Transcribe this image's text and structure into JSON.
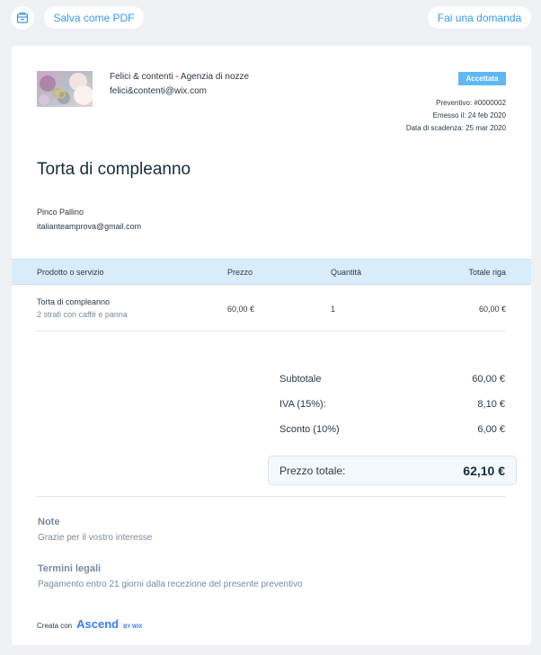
{
  "toolbar": {
    "icon": "archive-icon",
    "save_pdf_label": "Salva come PDF",
    "ask_label": "Fai una domanda"
  },
  "business": {
    "name": "Felici & contenti - Agenzia di nozze",
    "email": "felici&contenti@wix.com"
  },
  "status": {
    "label": "Accettata",
    "color": "#5eb8f5"
  },
  "meta": {
    "number": "Preventivo: #0000002",
    "issued": "Emesso il: 24 feb 2020",
    "due": "Data di scadenza: 25 mar 2020"
  },
  "title": "Torta di compleanno",
  "client": {
    "name": "Pinco Pallino",
    "email": "italianteamprova@gmail.com"
  },
  "table": {
    "headers": [
      "Prodotto o servizio",
      "Prezzo",
      "Quantità",
      "Totale riga"
    ],
    "rows": [
      {
        "name": "Torta di compleanno",
        "description": "2 strati con caffè e panna",
        "price": "60,00 €",
        "qty": "1",
        "total": "60,00 €"
      }
    ]
  },
  "totals": {
    "subtotal_label": "Subtotale",
    "subtotal": "60,00 €",
    "tax_label": "IVA (15%):",
    "tax": "8,10 €",
    "discount_label": "Sconto (10%)",
    "discount": "6,00 €",
    "grand_label": "Prezzo totale:",
    "grand": "62,10 €"
  },
  "notes": {
    "heading": "Note",
    "text": "Grazie per il vostro interesse"
  },
  "legal": {
    "heading": "Termini legali",
    "text": "Pagamento entro 21 giorni dalla recezione del presente preventivo"
  },
  "footer": {
    "made_with": "Creata con",
    "brand": "Ascend",
    "brand_sub": "BY WIX"
  },
  "colors": {
    "accent": "#3899ec",
    "background": "#eff1f5",
    "header_band": "#d9ecfa"
  }
}
